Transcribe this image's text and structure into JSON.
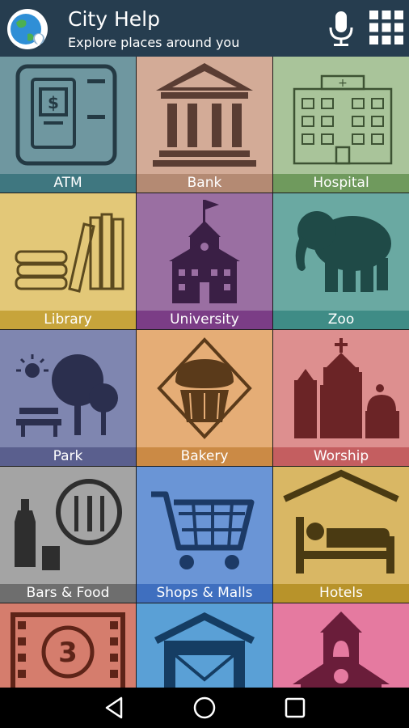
{
  "header": {
    "title": "City Help",
    "subtitle": "Explore places around you",
    "bg_color": "#263d4f"
  },
  "icons": {
    "logo": "globe-pin-icon",
    "voice": "microphone-icon",
    "menu": "grid-menu-icon"
  },
  "tiles": [
    {
      "label": "ATM",
      "icon": "atm-icon",
      "bg": "#6f97a0",
      "label_bg": "#3f7780"
    },
    {
      "label": "Bank",
      "icon": "bank-icon",
      "bg": "#d3ab97",
      "label_bg": "#b48a73"
    },
    {
      "label": "Hospital",
      "icon": "hospital-icon",
      "bg": "#a9c49a",
      "label_bg": "#6f9a5d"
    },
    {
      "label": "Library",
      "icon": "books-icon",
      "bg": "#e3c878",
      "label_bg": "#c7a43b"
    },
    {
      "label": "University",
      "icon": "university-icon",
      "bg": "#9a6fa2",
      "label_bg": "#7b3d86"
    },
    {
      "label": "Zoo",
      "icon": "elephant-icon",
      "bg": "#6aa9a2",
      "label_bg": "#3f8c86"
    },
    {
      "label": "Park",
      "icon": "park-icon",
      "bg": "#7f86b0",
      "label_bg": "#5a5f8e"
    },
    {
      "label": "Bakery",
      "icon": "cupcake-icon",
      "bg": "#e5ad76",
      "label_bg": "#cb8a45"
    },
    {
      "label": "Worship",
      "icon": "worship-icon",
      "bg": "#dd8f8f",
      "label_bg": "#c45e60"
    },
    {
      "label": "Bars & Food",
      "icon": "bars-food-icon",
      "bg": "#a4a4a4",
      "label_bg": "#6e6e6e"
    },
    {
      "label": "Shops & Malls",
      "icon": "shopping-cart-icon",
      "bg": "#6a95d6",
      "label_bg": "#3f6fbf"
    },
    {
      "label": "Hotels",
      "icon": "hotel-bed-icon",
      "bg": "#d9b764",
      "label_bg": "#b8932a"
    },
    {
      "label": "",
      "icon": "cinema-icon",
      "bg": "#d57d6d",
      "label_bg": "#b85a49"
    },
    {
      "label": "",
      "icon": "post-office-icon",
      "bg": "#5aa0d6",
      "label_bg": "#2f79b8"
    },
    {
      "label": "",
      "icon": "school-bell-icon",
      "bg": "#e57aa0",
      "label_bg": "#c74f7e"
    }
  ],
  "navbar": {
    "back_icon": "back-icon",
    "home_icon": "home-icon",
    "recents_icon": "recents-icon"
  }
}
